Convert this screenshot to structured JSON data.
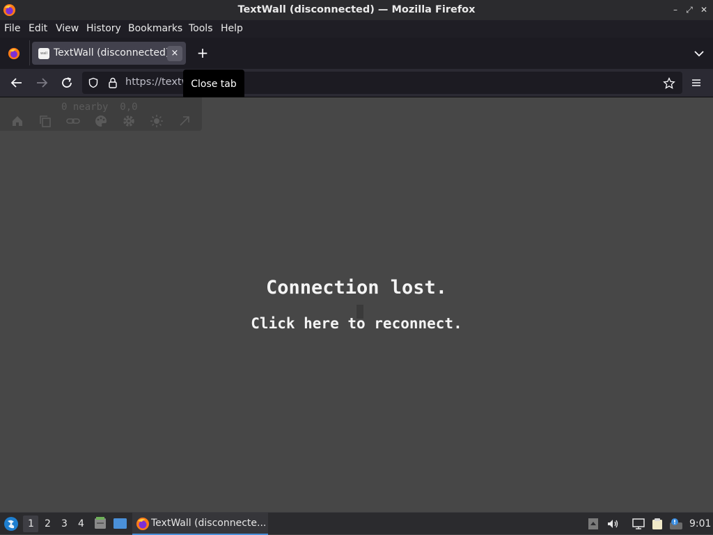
{
  "window": {
    "title": "TextWall (disconnected) — Mozilla Firefox",
    "controls": [
      "–",
      "⤢",
      "✕"
    ]
  },
  "menu": {
    "items": [
      "File",
      "Edit",
      "View",
      "History",
      "Bookmarks",
      "Tools",
      "Help"
    ]
  },
  "tabs": [
    {
      "label": "TextWall (disconnected)",
      "favicon": "textwall-favicon",
      "active": true,
      "close_icon": "×"
    }
  ],
  "new_tab_label": "+",
  "tab_list_icon": "chevron-down-icon",
  "navbar": {
    "url": "https://textw"
  },
  "tooltip": "Close tab",
  "textwall": {
    "status": "0 nearby  0,0",
    "tools": [
      "home-icon",
      "copy-icon",
      "link-icon",
      "palette-icon",
      "gear-icon",
      "sun-icon",
      "arrow-up-right-icon"
    ]
  },
  "page": {
    "message_title": "Connection lost.",
    "message_action": "Click here to reconnect."
  },
  "taskbar": {
    "workspaces": [
      "1",
      "2",
      "3",
      "4"
    ],
    "active_workspace": "1",
    "task_label": "TextWall (disconnecte...",
    "clock": "9:01"
  },
  "colors": {
    "page_background": "#474747",
    "chrome_dark": "#1c1b22",
    "taskbar_accent": "#4a90d9"
  }
}
